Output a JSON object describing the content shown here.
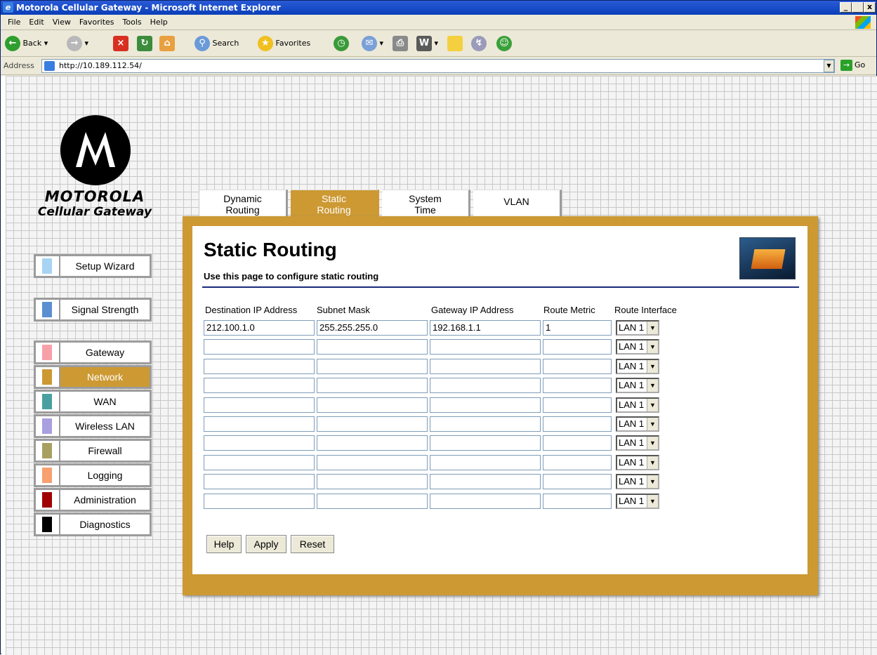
{
  "window": {
    "title": "Motorola Cellular Gateway - Microsoft Internet Explorer",
    "min": "_",
    "max": " ",
    "close": "x"
  },
  "menu": [
    "File",
    "Edit",
    "View",
    "Favorites",
    "Tools",
    "Help"
  ],
  "toolbar": {
    "back": "Back",
    "search": "Search",
    "favorites": "Favorites"
  },
  "address": {
    "label": "Address",
    "url": "http://10.189.112.54/",
    "go": "Go"
  },
  "brand": {
    "name": "MOTOROLA",
    "product": "Cellular Gateway"
  },
  "nav": [
    {
      "label": "Setup Wizard",
      "color": "#a8d4f4"
    },
    {
      "label": "Signal Strength",
      "color": "#5b8fd0"
    },
    {
      "label": "Gateway",
      "color": "#f8a0a8"
    },
    {
      "label": "Network",
      "color": "#cc9933"
    },
    {
      "label": "WAN",
      "color": "#4aa0a0"
    },
    {
      "label": "Wireless LAN",
      "color": "#a8a0e0"
    },
    {
      "label": "Firewall",
      "color": "#a8a060"
    },
    {
      "label": "Logging",
      "color": "#f8a070"
    },
    {
      "label": "Administration",
      "color": "#a00000"
    },
    {
      "label": "Diagnostics",
      "color": "#000000"
    }
  ],
  "tabs": [
    {
      "line1": "Dynamic",
      "line2": "Routing"
    },
    {
      "line1": "Static",
      "line2": "Routing"
    },
    {
      "line1": "System",
      "line2": "Time"
    },
    {
      "line1": "VLAN",
      "line2": ""
    }
  ],
  "page": {
    "title": "Static Routing",
    "subtitle": "Use this page to configure static routing"
  },
  "columns": [
    "Destination IP Address",
    "Subnet Mask",
    "Gateway IP Address",
    "Route Metric",
    "Route Interface"
  ],
  "rows": [
    {
      "dest": "212.100.1.0",
      "mask": "255.255.255.0",
      "gw": "192.168.1.1",
      "metric": "1",
      "iface": "LAN 1"
    },
    {
      "dest": "",
      "mask": "",
      "gw": "",
      "metric": "",
      "iface": "LAN 1"
    },
    {
      "dest": "",
      "mask": "",
      "gw": "",
      "metric": "",
      "iface": "LAN 1"
    },
    {
      "dest": "",
      "mask": "",
      "gw": "",
      "metric": "",
      "iface": "LAN 1"
    },
    {
      "dest": "",
      "mask": "",
      "gw": "",
      "metric": "",
      "iface": "LAN 1"
    },
    {
      "dest": "",
      "mask": "",
      "gw": "",
      "metric": "",
      "iface": "LAN 1"
    },
    {
      "dest": "",
      "mask": "",
      "gw": "",
      "metric": "",
      "iface": "LAN 1"
    },
    {
      "dest": "",
      "mask": "",
      "gw": "",
      "metric": "",
      "iface": "LAN 1"
    },
    {
      "dest": "",
      "mask": "",
      "gw": "",
      "metric": "",
      "iface": "LAN 1"
    },
    {
      "dest": "",
      "mask": "",
      "gw": "",
      "metric": "",
      "iface": "LAN 1"
    }
  ],
  "buttons": {
    "help": "Help",
    "apply": "Apply",
    "reset": "Reset"
  }
}
